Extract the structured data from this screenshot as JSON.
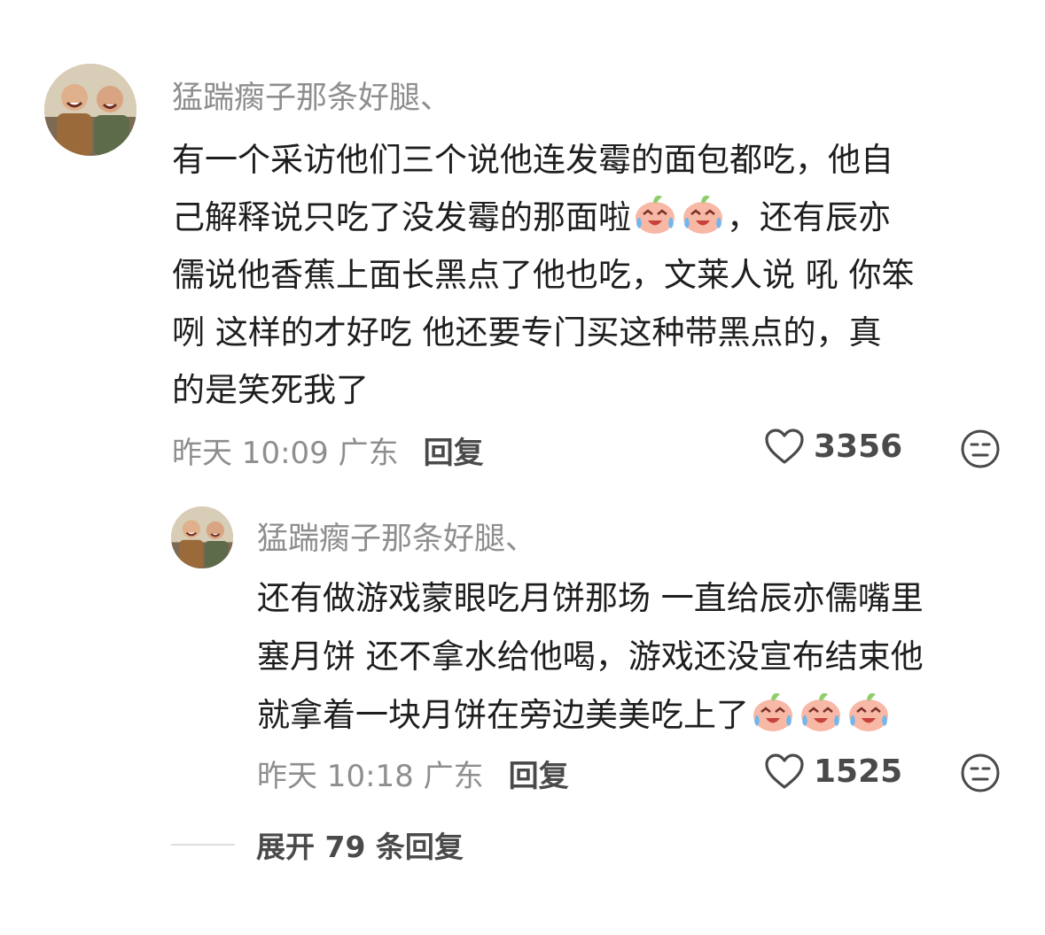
{
  "comments": [
    {
      "username": "猛踹瘸子那条好腿、",
      "lines": [
        "有一个采访他们三个说他连发霉的面包都吃，他自",
        "己解释说只吃了没发霉的那面啦",
        "，还有辰亦",
        "儒说他香蕉上面长黑点了他也吃，文莱人说 吼 你笨",
        "咧 这样的才好吃  他还要专门买这种带黑点的，真",
        "的是笑死我了"
      ],
      "emoji": "crying-laughing-peach-emoji",
      "meta": "昨天 10:09 广东",
      "reply_label": "回复",
      "like_count": "3356"
    },
    {
      "username": "猛踹瘸子那条好腿、",
      "lines": [
        "还有做游戏蒙眼吃月饼那场 一直给辰亦儒嘴里",
        "塞月饼 还不拿水给他喝，游戏还没宣布结束他",
        "就拿着一块月饼在旁边美美吃上了"
      ],
      "emoji": "crying-laughing-peach-emoji",
      "meta": "昨天 10:18 广东",
      "reply_label": "回复",
      "like_count": "1525"
    }
  ],
  "expand_label": "展开 79 条回复",
  "icons": {
    "like": "heart-outline-icon",
    "dislike": "meh-face-icon"
  },
  "colors": {
    "text": "#1e1e1e",
    "muted": "#8e8e8e",
    "secondary": "#4a4a4a",
    "emoji_body": "#f7b8a6",
    "emoji_leaf": "#8fce6a",
    "emoji_tears": "#6fb7ee"
  }
}
